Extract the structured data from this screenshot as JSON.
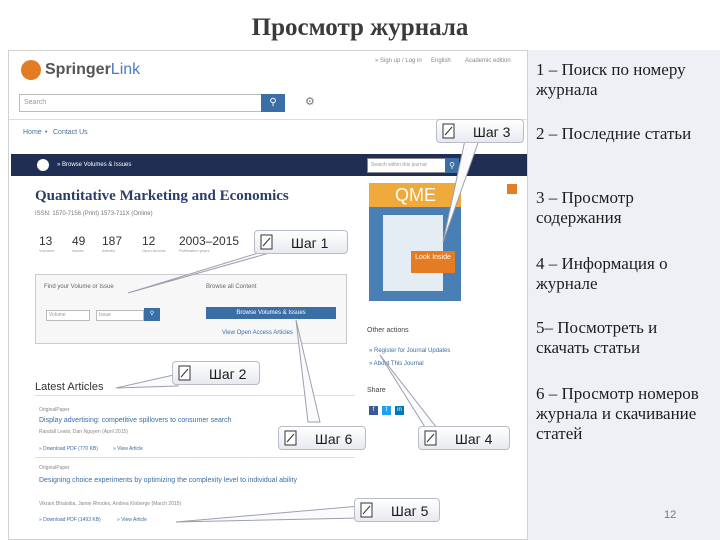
{
  "slide": {
    "title": "Просмотр журнала",
    "page_number": "12",
    "steps": [
      "1 – Поиск по номеру журнала",
      "2 – Последние статьи",
      "3 – Просмотр содержания",
      "4 – Информация о журнале",
      "5– Посмотреть и скачать статьи",
      "6 – Просмотр номеров журнала и скачивание статей"
    ],
    "callouts": {
      "step1": "Шаг 1",
      "step2": "Шаг 2",
      "step3": "Шаг 3",
      "step4": "Шаг 4",
      "step5": "Шаг 5",
      "step6": "Шаг 6"
    }
  },
  "screenshot": {
    "logo": {
      "brand": "Springer",
      "suffix": "Link"
    },
    "top_nav": [
      "» Sign up / Log in",
      "English",
      "Academic edition"
    ],
    "search": {
      "placeholder": "Search"
    },
    "breadcrumb": [
      "Home",
      "Contact Us"
    ],
    "browse_bar": "» Browse Volumes & Issues",
    "within_search_placeholder": "Search within this journal",
    "journal": {
      "title": "Quantitative Marketing and Economics",
      "issn": "ISSN: 1570-7156 (Print) 1573-711X (Online)",
      "stats": [
        {
          "value": "13",
          "label": "Volumes"
        },
        {
          "value": "49",
          "label": "Issues"
        },
        {
          "value": "187",
          "label": "Articles"
        },
        {
          "value": "12",
          "label": "Open Access"
        },
        {
          "value": "2003–2015",
          "label": "Publication years"
        }
      ],
      "cover_text": "QME",
      "look_inside": "Look Inside"
    },
    "find_volume": {
      "heading": "Find your Volume or Issue",
      "volume_placeholder": "Volume",
      "issue_placeholder": "Issue"
    },
    "browse_all": {
      "heading": "Browse all Content",
      "button": "Browse Volumes & Issues",
      "link": "View Open Access Articles"
    },
    "other_actions": {
      "heading": "Other actions",
      "links": [
        "» Register for Journal Updates",
        "» About This Journal"
      ]
    },
    "share": {
      "heading": "Share"
    },
    "latest_articles": {
      "heading": "Latest Articles",
      "items": [
        {
          "type": "OriginalPaper",
          "title": "Display advertising: competitive spillovers to consumer search",
          "authors": "Randall Lewis, Dan Nguyen (April 2015)",
          "download": "» Download PDF (770 KB)",
          "view": "» View Article"
        },
        {
          "type": "OriginalPaper",
          "title": "Designing choice experiments by optimizing the complexity level to individual ability",
          "authors": "Vikrant Bhalodia, Jamie Rhodes, Andrea Kloberge (March 2015)",
          "download": "» Download PDF (1493 KB)",
          "view": "» View Article"
        }
      ]
    }
  }
}
